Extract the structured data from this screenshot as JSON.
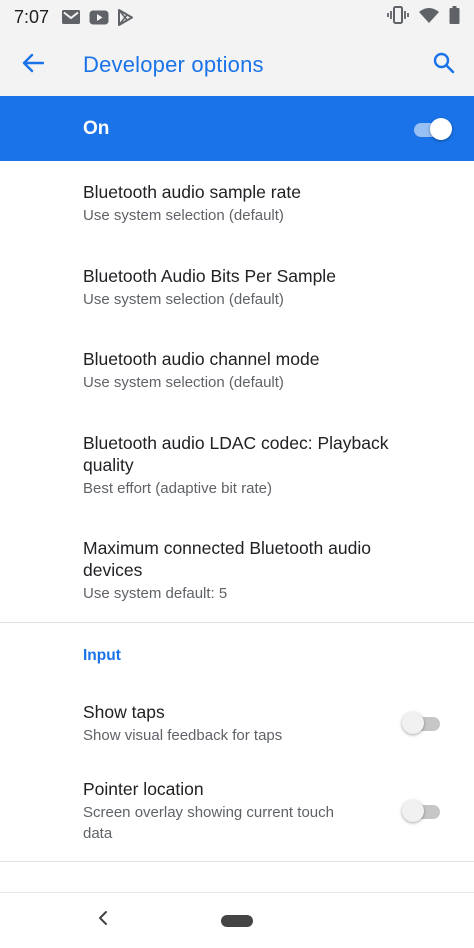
{
  "status_bar": {
    "time": "7:07",
    "left_icons": [
      "gmail-icon",
      "youtube-icon",
      "play-store-icon"
    ],
    "right_icons": [
      "vibrate-icon",
      "wifi-icon",
      "battery-icon"
    ]
  },
  "app_bar": {
    "title": "Developer options",
    "back_icon": "arrow-back-icon",
    "search_icon": "search-icon"
  },
  "master_switch": {
    "label": "On",
    "checked": true
  },
  "items": [
    {
      "title": "Bluetooth audio sample rate",
      "summary": "Use system selection (default)"
    },
    {
      "title": "Bluetooth Audio Bits Per Sample",
      "summary": "Use system selection (default)"
    },
    {
      "title": "Bluetooth audio channel mode",
      "summary": "Use system selection (default)"
    },
    {
      "title": "Bluetooth audio LDAC codec: Playback quality",
      "summary": "Best effort (adaptive bit rate)"
    },
    {
      "title": "Maximum connected Bluetooth audio devices",
      "summary": "Use system default: 5"
    }
  ],
  "input_section": {
    "header": "Input",
    "items": [
      {
        "title": "Show taps",
        "summary": "Show visual feedback for taps",
        "checked": false
      },
      {
        "title": "Pointer location",
        "summary": "Screen overlay showing current touch data",
        "checked": false
      }
    ]
  },
  "colors": {
    "accent": "#1a73e8",
    "bar_bg": "#f3f3f3"
  }
}
